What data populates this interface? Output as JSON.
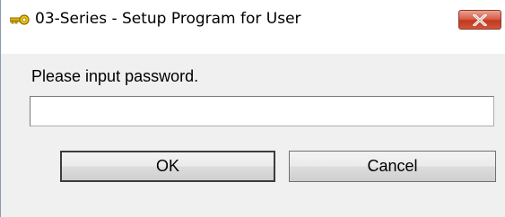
{
  "window": {
    "title": "03-Series - Setup Program for User",
    "icon": "key-icon",
    "close_icon": "close-icon"
  },
  "dialog": {
    "prompt": "Please input password.",
    "password_value": "",
    "ok_label": "OK",
    "cancel_label": "Cancel"
  },
  "colors": {
    "close_button": "#c94a31",
    "key_icon": "#e2b400"
  }
}
